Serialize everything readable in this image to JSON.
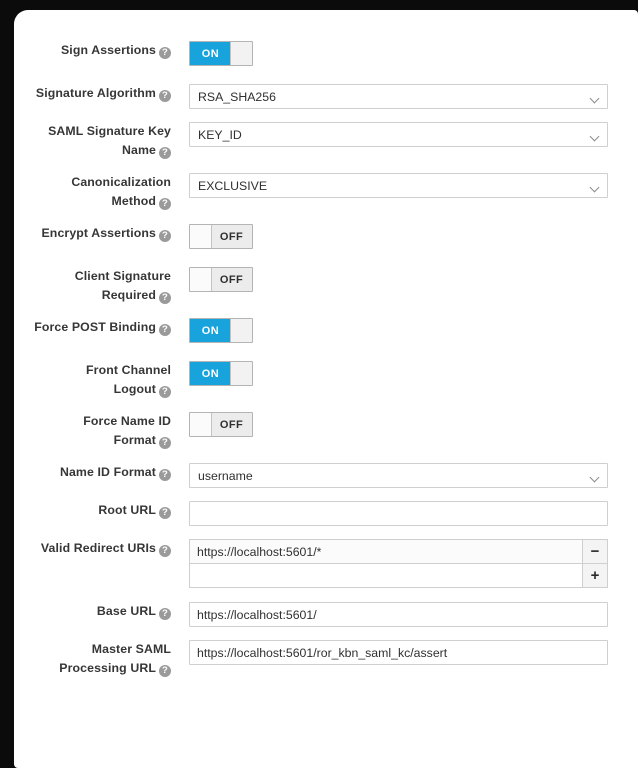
{
  "form": {
    "rows": [
      {
        "id": "sign-assertions",
        "label": "Sign Assertions",
        "label_lines": [
          "Sign Assertions"
        ],
        "type": "toggle",
        "value": "ON",
        "help": "?"
      },
      {
        "id": "signature-algorithm",
        "label": "Signature Algorithm",
        "label_lines": [
          "Signature Algorithm"
        ],
        "type": "select",
        "value": "RSA_SHA256",
        "help": "?"
      },
      {
        "id": "saml-signature-key-name",
        "label": "SAML Signature Key Name",
        "label_lines": [
          "SAML Signature Key",
          "Name"
        ],
        "type": "select",
        "value": "KEY_ID",
        "help": "?"
      },
      {
        "id": "canonicalization-method",
        "label": "Canonicalization Method",
        "label_lines": [
          "Canonicalization",
          "Method"
        ],
        "type": "select",
        "value": "EXCLUSIVE",
        "help": "?"
      },
      {
        "id": "encrypt-assertions",
        "label": "Encrypt Assertions",
        "label_lines": [
          "Encrypt Assertions"
        ],
        "type": "toggle",
        "value": "OFF",
        "help": "?"
      },
      {
        "id": "client-signature-required",
        "label": "Client Signature Required",
        "label_lines": [
          "Client Signature",
          "Required"
        ],
        "type": "toggle",
        "value": "OFF",
        "help": "?"
      },
      {
        "id": "force-post-binding",
        "label": "Force POST Binding",
        "label_lines": [
          "Force POST Binding"
        ],
        "type": "toggle",
        "value": "ON",
        "help": "?"
      },
      {
        "id": "front-channel-logout",
        "label": "Front Channel Logout",
        "label_lines": [
          "Front Channel",
          "Logout"
        ],
        "type": "toggle",
        "value": "ON",
        "help": "?"
      },
      {
        "id": "force-name-id-format",
        "label": "Force Name ID Format",
        "label_lines": [
          "Force Name ID",
          "Format"
        ],
        "type": "toggle",
        "value": "OFF",
        "help": "?"
      },
      {
        "id": "name-id-format",
        "label": "Name ID Format",
        "label_lines": [
          "Name ID Format"
        ],
        "type": "select",
        "value": "username",
        "help": "?"
      },
      {
        "id": "root-url",
        "label": "Root URL",
        "label_lines": [
          "Root URL"
        ],
        "type": "input",
        "value": "",
        "placeholder": "",
        "help": "?"
      },
      {
        "id": "valid-redirect-uris",
        "label": "Valid Redirect URIs",
        "label_lines": [
          "Valid Redirect URIs"
        ],
        "type": "multi",
        "entries": [
          {
            "value": "https://localhost:5601/*",
            "button": "−",
            "button_name": "remove-redirect-uri-button"
          },
          {
            "value": "",
            "button": "+",
            "button_name": "add-redirect-uri-button"
          }
        ],
        "help": "?"
      },
      {
        "id": "base-url",
        "label": "Base URL",
        "label_lines": [
          "Base URL"
        ],
        "type": "input",
        "value": "https://localhost:5601/",
        "placeholder": "",
        "help": "?"
      },
      {
        "id": "master-saml-processing-url",
        "label": "Master SAML Processing URL",
        "label_lines": [
          "Master SAML",
          "Processing URL"
        ],
        "type": "input",
        "value": "https://localhost:5601/ror_kbn_saml_kc/assert",
        "placeholder": "",
        "help": "?"
      }
    ]
  },
  "colors": {
    "toggle_on": "#18a3dd",
    "toggle_off_track": "#ececec",
    "label_text": "#363636",
    "input_border": "#cfcfcf",
    "help_icon": "#9a9a9a",
    "card_background": "#ffffff"
  }
}
